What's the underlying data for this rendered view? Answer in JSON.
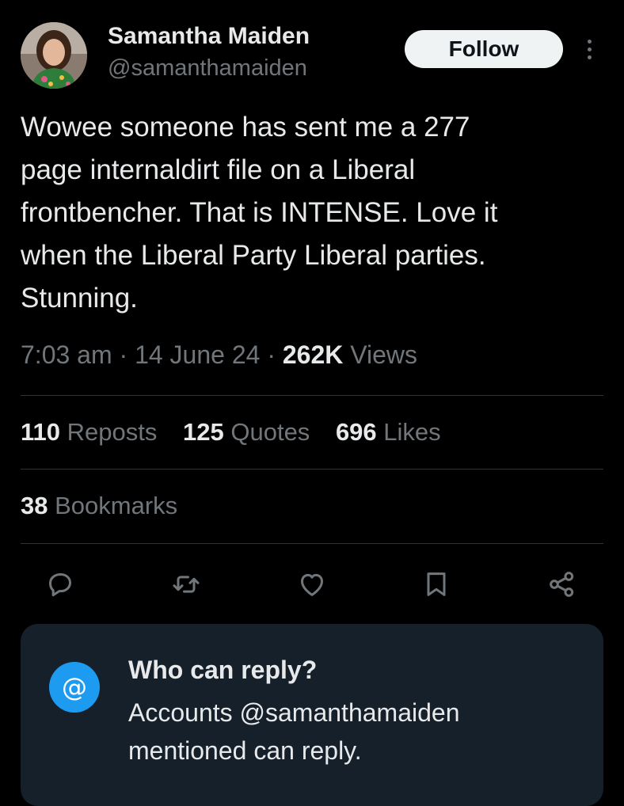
{
  "author": {
    "display_name": "Samantha Maiden",
    "handle": "@samanthamaiden",
    "avatar_icon": "profile-photo"
  },
  "header": {
    "follow_label": "Follow",
    "more_icon": "vertical-ellipsis-icon"
  },
  "tweet": {
    "text": "Wowee someone has sent me a 277\npage internaldirt file on a Liberal\nfrontbencher. That is INTENSE. Love it\nwhen the Liberal Party Liberal parties.\nStunning.",
    "time": "7:03 am",
    "separator": "·",
    "date": "14 June 24",
    "views_count": "262K",
    "views_label": "Views"
  },
  "stats": {
    "reposts_count": "110",
    "reposts_label": "Reposts",
    "quotes_count": "125",
    "quotes_label": "Quotes",
    "likes_count": "696",
    "likes_label": "Likes",
    "bookmarks_count": "38",
    "bookmarks_label": "Bookmarks"
  },
  "actions": [
    "reply-icon",
    "repost-icon",
    "like-icon",
    "bookmark-icon",
    "share-icon"
  ],
  "reply_restriction": {
    "badge": "@",
    "title": "Who can reply?",
    "description": "Accounts @samanthamaiden mentioned can reply."
  },
  "colors": {
    "background": "#000000",
    "text_primary": "#e7e9ea",
    "text_secondary": "#71767b",
    "divider": "#2f3336",
    "card_bg": "#15202b",
    "accent": "#1d9bf0"
  }
}
